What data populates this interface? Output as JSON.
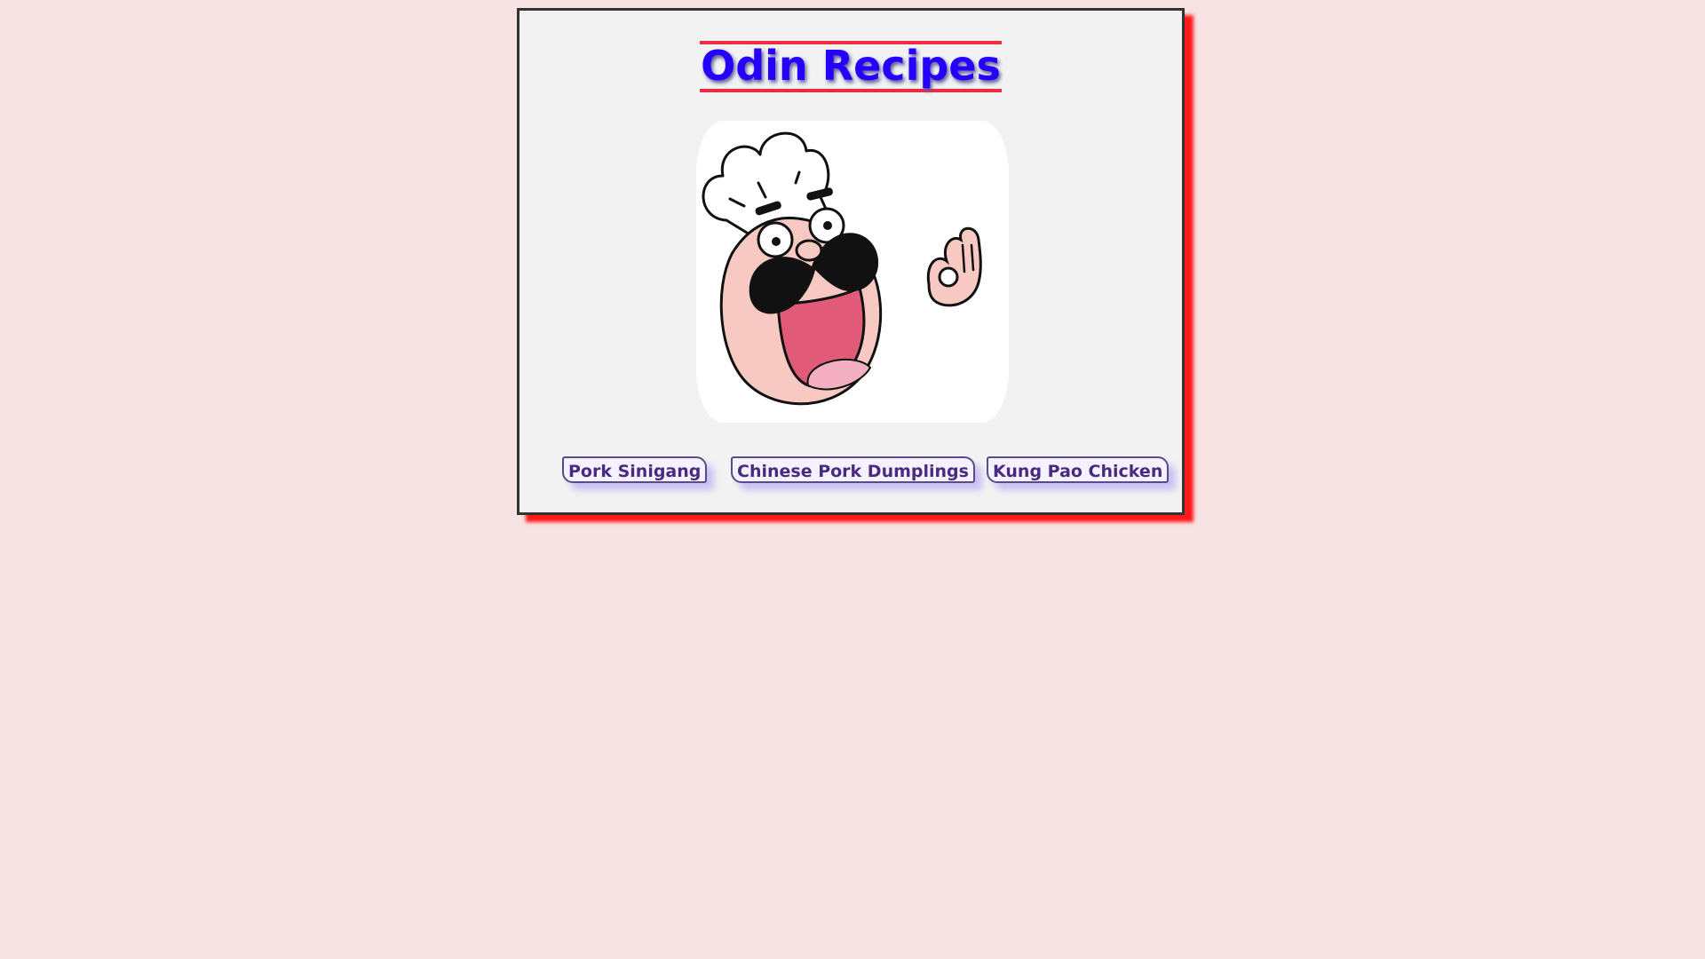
{
  "page": {
    "title": "Odin Recipes"
  },
  "mascot": {
    "icon": "chef-mascot-icon"
  },
  "links": [
    {
      "label": "Pork Sinigang"
    },
    {
      "label": "Chinese Pork Dumplings"
    },
    {
      "label": "Kung Pao Chicken"
    }
  ],
  "colors": {
    "background": "#f7e3e3",
    "card": "#f2f2f2",
    "card_shadow": "#ff1a1a",
    "title": "#2600ff",
    "title_rule": "#ee2a44",
    "link_text": "#4a2a80",
    "link_shadow": "#c9c0f2"
  }
}
